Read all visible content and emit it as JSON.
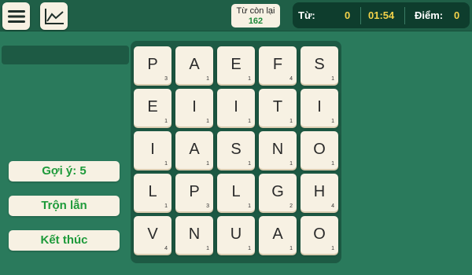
{
  "topbar": {
    "words_left_label": "Từ còn lại",
    "words_left_value": "162",
    "words_label": "Từ:",
    "words_value": "0",
    "timer": "01:54",
    "score_label": "Điểm:",
    "score_value": "0"
  },
  "icons": {
    "menu": "menu-icon",
    "stats": "chart-icon"
  },
  "sidebar": {
    "hint_label": "Gợi ý: 5",
    "shuffle_label": "Trộn lẫn",
    "end_label": "Kết thúc"
  },
  "board": {
    "rows": [
      [
        {
          "l": "P",
          "p": "3"
        },
        {
          "l": "A",
          "p": "1"
        },
        {
          "l": "E",
          "p": "1"
        },
        {
          "l": "F",
          "p": "4"
        },
        {
          "l": "S",
          "p": "1"
        }
      ],
      [
        {
          "l": "E",
          "p": "1"
        },
        {
          "l": "I",
          "p": "1"
        },
        {
          "l": "I",
          "p": "1"
        },
        {
          "l": "T",
          "p": "1"
        },
        {
          "l": "I",
          "p": "1"
        }
      ],
      [
        {
          "l": "I",
          "p": "1"
        },
        {
          "l": "A",
          "p": "1"
        },
        {
          "l": "S",
          "p": "1"
        },
        {
          "l": "N",
          "p": "1"
        },
        {
          "l": "O",
          "p": "1"
        }
      ],
      [
        {
          "l": "L",
          "p": "1"
        },
        {
          "l": "P",
          "p": "3"
        },
        {
          "l": "L",
          "p": "1"
        },
        {
          "l": "G",
          "p": "2"
        },
        {
          "l": "H",
          "p": "4"
        }
      ],
      [
        {
          "l": "V",
          "p": "4"
        },
        {
          "l": "N",
          "p": "1"
        },
        {
          "l": "U",
          "p": "1"
        },
        {
          "l": "A",
          "p": "1"
        },
        {
          "l": "O",
          "p": "1"
        }
      ]
    ]
  },
  "colors": {
    "background": "#2a7a5c",
    "topbar": "#1f5f47",
    "tile": "#f7f1e3",
    "accent_green": "#1e9a3a",
    "timer_yellow": "#f3d24a"
  }
}
